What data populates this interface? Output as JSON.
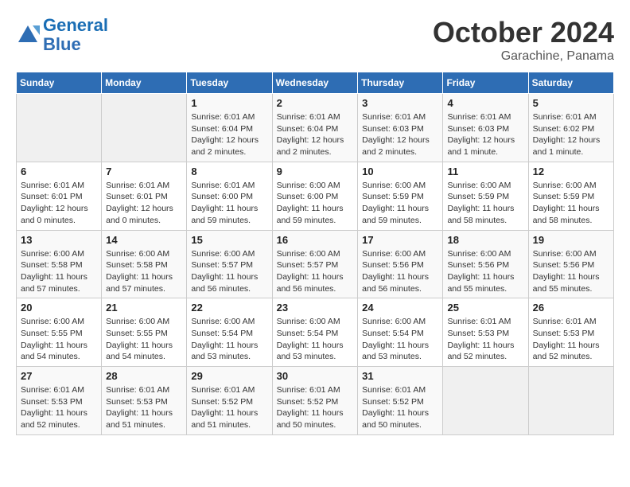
{
  "logo": {
    "line1": "General",
    "line2": "Blue"
  },
  "title": "October 2024",
  "subtitle": "Garachine, Panama",
  "days_header": [
    "Sunday",
    "Monday",
    "Tuesday",
    "Wednesday",
    "Thursday",
    "Friday",
    "Saturday"
  ],
  "weeks": [
    [
      {
        "day": "",
        "info": ""
      },
      {
        "day": "",
        "info": ""
      },
      {
        "day": "1",
        "info": "Sunrise: 6:01 AM\nSunset: 6:04 PM\nDaylight: 12 hours and 2 minutes."
      },
      {
        "day": "2",
        "info": "Sunrise: 6:01 AM\nSunset: 6:04 PM\nDaylight: 12 hours and 2 minutes."
      },
      {
        "day": "3",
        "info": "Sunrise: 6:01 AM\nSunset: 6:03 PM\nDaylight: 12 hours and 2 minutes."
      },
      {
        "day": "4",
        "info": "Sunrise: 6:01 AM\nSunset: 6:03 PM\nDaylight: 12 hours and 1 minute."
      },
      {
        "day": "5",
        "info": "Sunrise: 6:01 AM\nSunset: 6:02 PM\nDaylight: 12 hours and 1 minute."
      }
    ],
    [
      {
        "day": "6",
        "info": "Sunrise: 6:01 AM\nSunset: 6:01 PM\nDaylight: 12 hours and 0 minutes."
      },
      {
        "day": "7",
        "info": "Sunrise: 6:01 AM\nSunset: 6:01 PM\nDaylight: 12 hours and 0 minutes."
      },
      {
        "day": "8",
        "info": "Sunrise: 6:01 AM\nSunset: 6:00 PM\nDaylight: 11 hours and 59 minutes."
      },
      {
        "day": "9",
        "info": "Sunrise: 6:00 AM\nSunset: 6:00 PM\nDaylight: 11 hours and 59 minutes."
      },
      {
        "day": "10",
        "info": "Sunrise: 6:00 AM\nSunset: 5:59 PM\nDaylight: 11 hours and 59 minutes."
      },
      {
        "day": "11",
        "info": "Sunrise: 6:00 AM\nSunset: 5:59 PM\nDaylight: 11 hours and 58 minutes."
      },
      {
        "day": "12",
        "info": "Sunrise: 6:00 AM\nSunset: 5:59 PM\nDaylight: 11 hours and 58 minutes."
      }
    ],
    [
      {
        "day": "13",
        "info": "Sunrise: 6:00 AM\nSunset: 5:58 PM\nDaylight: 11 hours and 57 minutes."
      },
      {
        "day": "14",
        "info": "Sunrise: 6:00 AM\nSunset: 5:58 PM\nDaylight: 11 hours and 57 minutes."
      },
      {
        "day": "15",
        "info": "Sunrise: 6:00 AM\nSunset: 5:57 PM\nDaylight: 11 hours and 56 minutes."
      },
      {
        "day": "16",
        "info": "Sunrise: 6:00 AM\nSunset: 5:57 PM\nDaylight: 11 hours and 56 minutes."
      },
      {
        "day": "17",
        "info": "Sunrise: 6:00 AM\nSunset: 5:56 PM\nDaylight: 11 hours and 56 minutes."
      },
      {
        "day": "18",
        "info": "Sunrise: 6:00 AM\nSunset: 5:56 PM\nDaylight: 11 hours and 55 minutes."
      },
      {
        "day": "19",
        "info": "Sunrise: 6:00 AM\nSunset: 5:56 PM\nDaylight: 11 hours and 55 minutes."
      }
    ],
    [
      {
        "day": "20",
        "info": "Sunrise: 6:00 AM\nSunset: 5:55 PM\nDaylight: 11 hours and 54 minutes."
      },
      {
        "day": "21",
        "info": "Sunrise: 6:00 AM\nSunset: 5:55 PM\nDaylight: 11 hours and 54 minutes."
      },
      {
        "day": "22",
        "info": "Sunrise: 6:00 AM\nSunset: 5:54 PM\nDaylight: 11 hours and 53 minutes."
      },
      {
        "day": "23",
        "info": "Sunrise: 6:00 AM\nSunset: 5:54 PM\nDaylight: 11 hours and 53 minutes."
      },
      {
        "day": "24",
        "info": "Sunrise: 6:00 AM\nSunset: 5:54 PM\nDaylight: 11 hours and 53 minutes."
      },
      {
        "day": "25",
        "info": "Sunrise: 6:01 AM\nSunset: 5:53 PM\nDaylight: 11 hours and 52 minutes."
      },
      {
        "day": "26",
        "info": "Sunrise: 6:01 AM\nSunset: 5:53 PM\nDaylight: 11 hours and 52 minutes."
      }
    ],
    [
      {
        "day": "27",
        "info": "Sunrise: 6:01 AM\nSunset: 5:53 PM\nDaylight: 11 hours and 52 minutes."
      },
      {
        "day": "28",
        "info": "Sunrise: 6:01 AM\nSunset: 5:53 PM\nDaylight: 11 hours and 51 minutes."
      },
      {
        "day": "29",
        "info": "Sunrise: 6:01 AM\nSunset: 5:52 PM\nDaylight: 11 hours and 51 minutes."
      },
      {
        "day": "30",
        "info": "Sunrise: 6:01 AM\nSunset: 5:52 PM\nDaylight: 11 hours and 50 minutes."
      },
      {
        "day": "31",
        "info": "Sunrise: 6:01 AM\nSunset: 5:52 PM\nDaylight: 11 hours and 50 minutes."
      },
      {
        "day": "",
        "info": ""
      },
      {
        "day": "",
        "info": ""
      }
    ]
  ]
}
